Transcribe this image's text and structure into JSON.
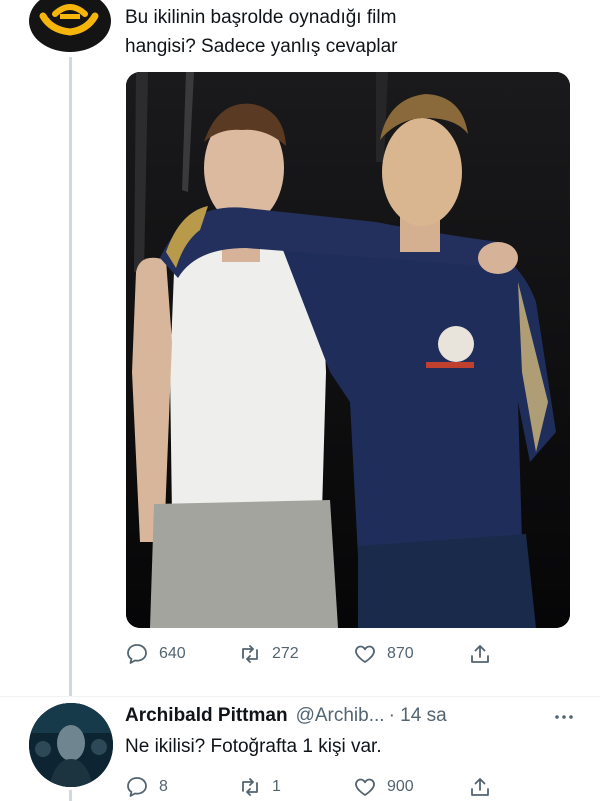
{
  "tweet": {
    "text_line1": "Bu ikilinin başrolde oynadığı film",
    "text_line2": "hangisi? Sadece yanlış cevaplar",
    "actions": {
      "replies": "640",
      "retweets": "272",
      "likes": "870"
    }
  },
  "reply": {
    "name": "Archibald Pittman",
    "handle": "@Archib...",
    "time": "· 14 sa",
    "text": "Ne ikilisi? Fotoğrafta 1 kişi var.",
    "actions": {
      "replies": "8",
      "retweets": "1",
      "likes": "900"
    }
  },
  "colors": {
    "icon_gray": "#536471",
    "brand_yellow": "#f5b50a",
    "thread_line": "#cfd9de"
  },
  "icons": [
    "reply-icon",
    "retweet-icon",
    "like-icon",
    "share-icon",
    "more-icon"
  ]
}
